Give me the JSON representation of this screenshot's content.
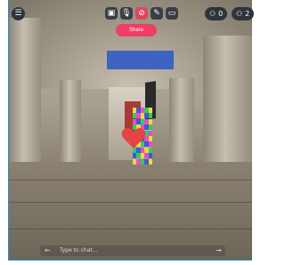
{
  "toolbar": {
    "menu_icon": "menu-icon",
    "buttons": [
      {
        "name": "camera-icon",
        "glyph": "▣"
      },
      {
        "name": "microphone-icon",
        "glyph": "🎙"
      },
      {
        "name": "mute-icon",
        "glyph": "⊘"
      },
      {
        "name": "pen-icon",
        "glyph": "✎"
      },
      {
        "name": "media-icon",
        "glyph": "▭"
      }
    ]
  },
  "share": {
    "label": "Share"
  },
  "counters": {
    "objects_count": "0",
    "people_count": "2"
  },
  "chat": {
    "placeholder": "Type to chat..."
  },
  "colors": {
    "share": "#ef3e66",
    "blue_object": "#3f63c3",
    "heart": "#e44444"
  }
}
